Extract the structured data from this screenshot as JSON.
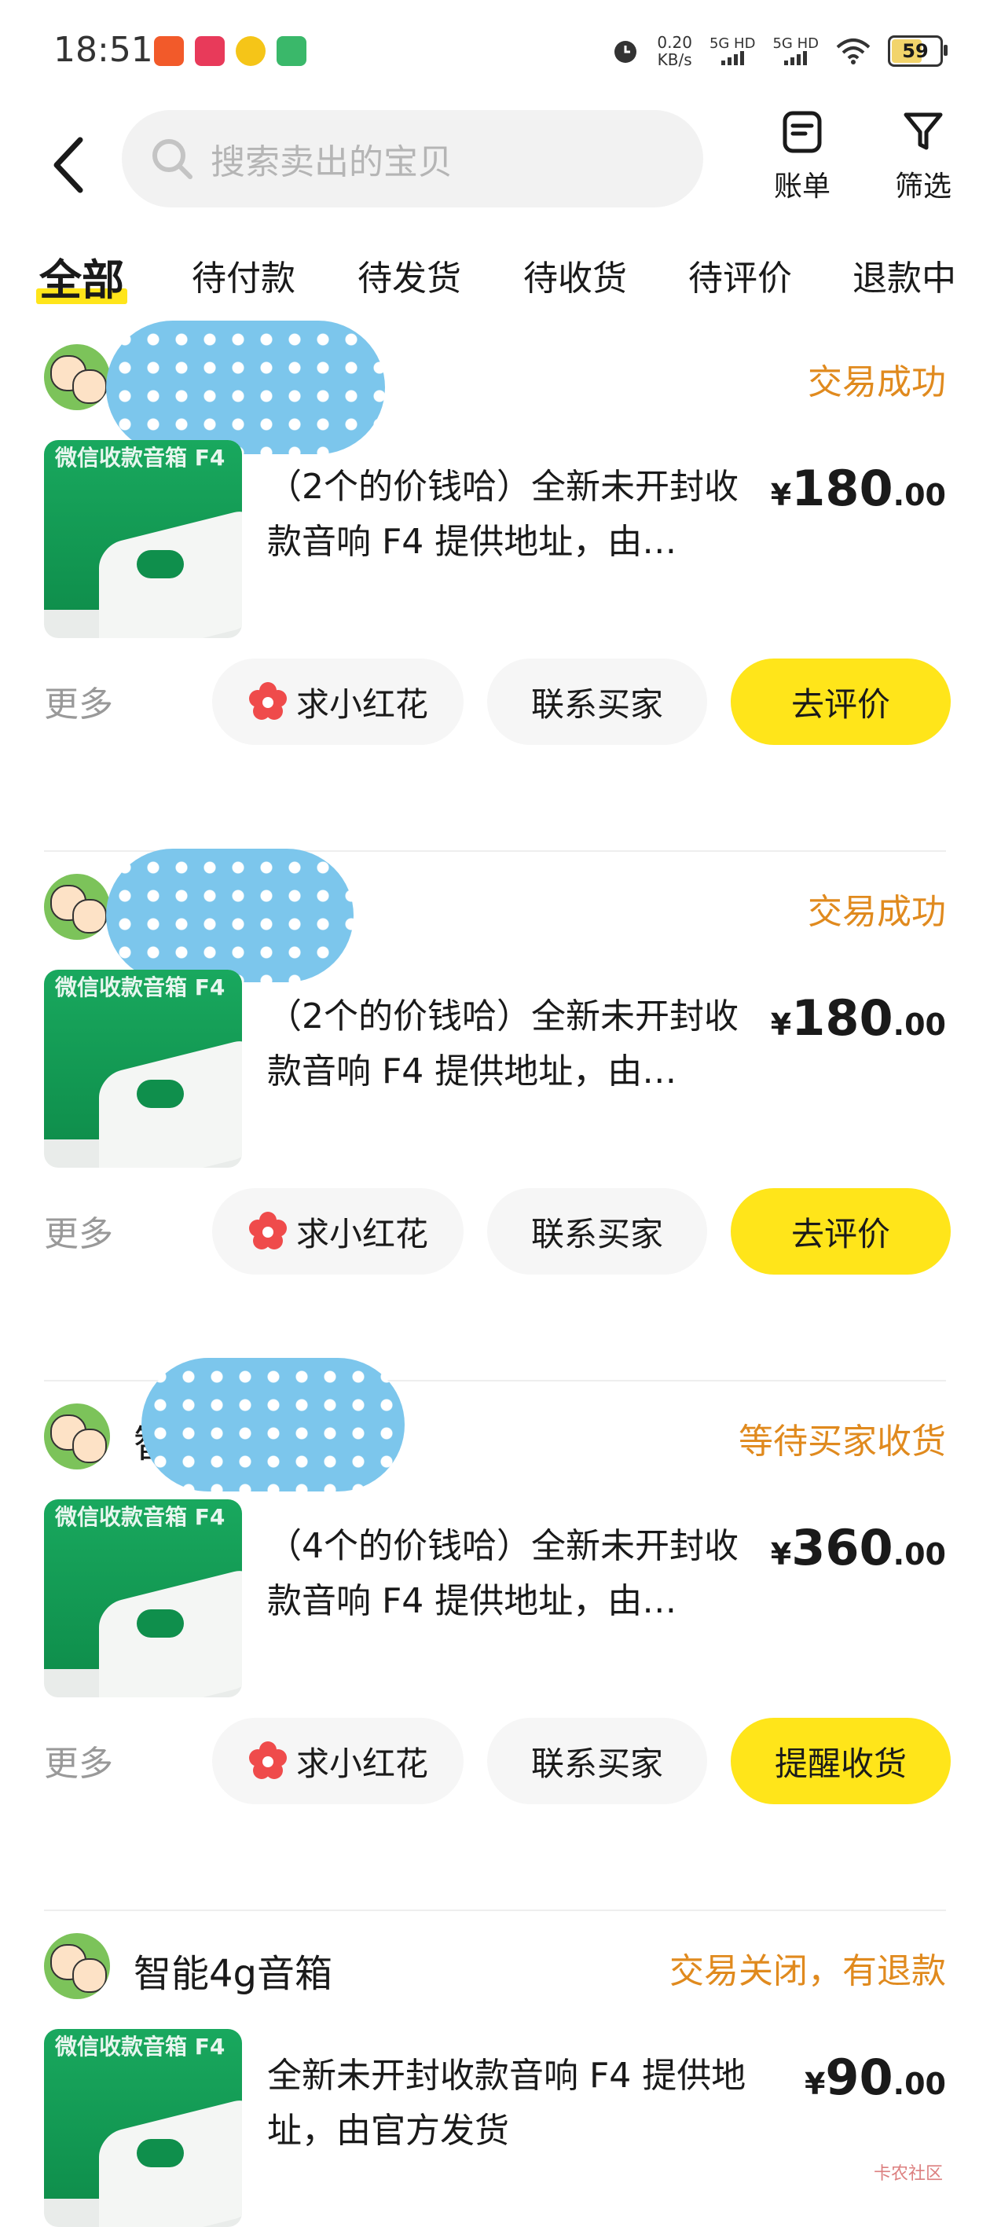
{
  "status_bar": {
    "time": "18:51",
    "net_speed": "0.20",
    "net_unit": "KB/s",
    "sim1": "5G HD",
    "sim2": "5G HD",
    "battery": "59"
  },
  "header": {
    "search_placeholder": "搜索卖出的宝贝",
    "bill_label": "账单",
    "filter_label": "筛选"
  },
  "tabs": [
    {
      "label": "全部",
      "active": true
    },
    {
      "label": "待付款"
    },
    {
      "label": "待发货"
    },
    {
      "label": "待收货"
    },
    {
      "label": "待评价"
    },
    {
      "label": "退款中"
    }
  ],
  "orders": [
    {
      "seller": "",
      "status": "交易成功",
      "title": "（2个的价钱哈）全新未开封收款音响 F4 提供地址，由…",
      "price_currency": "¥",
      "price_int": "180",
      "price_dec": ".00",
      "more": "更多",
      "btn_flower": "求小红花",
      "btn_contact": "联系买家",
      "btn_primary": "去评价",
      "thumb_title": "微信收款音箱 F4"
    },
    {
      "seller": "",
      "status": "交易成功",
      "title": "（2个的价钱哈）全新未开封收款音响 F4 提供地址，由…",
      "price_currency": "¥",
      "price_int": "180",
      "price_dec": ".00",
      "more": "更多",
      "btn_flower": "求小红花",
      "btn_contact": "联系买家",
      "btn_primary": "去评价",
      "thumb_title": "微信收款音箱 F4"
    },
    {
      "seller": "智",
      "status": "等待买家收货",
      "title": "（4个的价钱哈）全新未开封收款音响 F4 提供地址，由…",
      "price_currency": "¥",
      "price_int": "360",
      "price_dec": ".00",
      "more": "更多",
      "btn_flower": "求小红花",
      "btn_contact": "联系买家",
      "btn_primary": "提醒收货",
      "thumb_title": "微信收款音箱 F4"
    },
    {
      "seller": "智能4g音箱",
      "status": "交易关闭，有退款",
      "title": "全新未开封收款音响 F4 提供地址，由官方发货",
      "price_currency": "¥",
      "price_int": "90",
      "price_dec": ".00",
      "thumb_title": "微信收款音箱 F4"
    }
  ],
  "watermark": "卡农社区",
  "colors": {
    "accent_yellow": "#ffe51a",
    "status_orange": "#e08a1e",
    "blob_blue": "#7cc6ec",
    "thumb_green": "#19a85e"
  }
}
